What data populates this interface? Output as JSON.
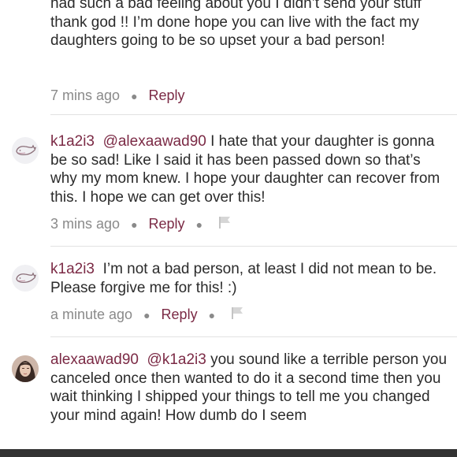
{
  "comments": [
    {
      "text": "had such a bad feeling about you I didn’t send your stuff thank god !! I’m done hope you can live with the fact my daughters going to be so upset your a bad person!",
      "time": "7 mins ago",
      "reply": "Reply"
    },
    {
      "username": "k1a2i3",
      "mention": "@alexaawad90",
      "text": "I hate that your daughter is gonna be so sad! Like I said it has been passed down so that’s why my mom knew. I hope your daughter can recover from this. I hope we can get over this!",
      "time": "3 mins ago",
      "reply": "Reply"
    },
    {
      "username": "k1a2i3",
      "text": "I’m not a bad person, at least I did not mean to be. Please forgive me for this! :)",
      "time": "a minute ago",
      "reply": "Reply"
    },
    {
      "username": "alexaawad90",
      "mention": "@k1a2i3",
      "text": "you sound like a terrible person you canceled once then wanted to do it a second time then you wait thinking I shipped your things to tell me you changed your mind again! How dumb do I seem"
    }
  ],
  "icons": {
    "avatar_default": "whale-icon",
    "flag": "flag-icon"
  },
  "colors": {
    "accent": "#7b2a45",
    "meta": "#8a8a8a"
  }
}
